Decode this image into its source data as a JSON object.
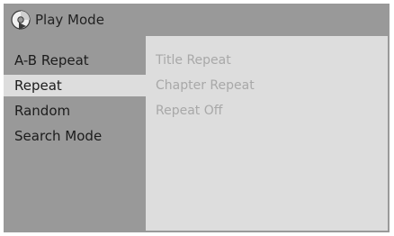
{
  "header": {
    "title": "Play Mode",
    "icon": "disc-icon"
  },
  "menu": {
    "items": [
      {
        "label": "A-B Repeat",
        "selected": false
      },
      {
        "label": "Repeat",
        "selected": true
      },
      {
        "label": "Random",
        "selected": false
      },
      {
        "label": "Search Mode",
        "selected": false
      }
    ]
  },
  "submenu": {
    "options": [
      {
        "label": "Title Repeat"
      },
      {
        "label": "Chapter Repeat"
      },
      {
        "label": "Repeat Off"
      }
    ]
  },
  "colors": {
    "panel": "#999999",
    "selected_highlight": "#dddddd",
    "submenu_background": "#dddddd",
    "menu_text": "#1c1c1c",
    "submenu_text": "#a8a8a8"
  }
}
